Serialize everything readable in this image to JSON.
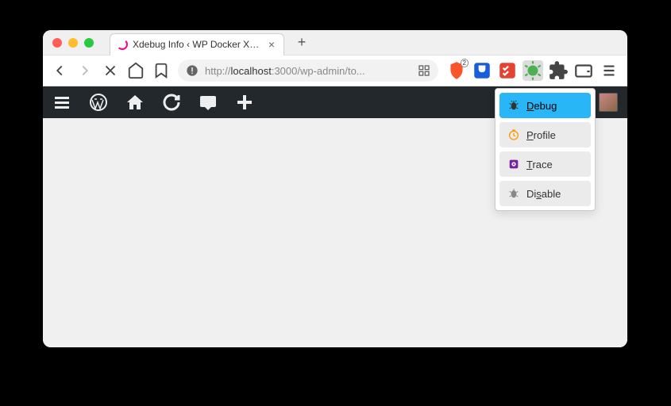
{
  "tab": {
    "title": "Xdebug Info ‹ WP Docker Xdebu"
  },
  "address": {
    "prefix": "http://",
    "host": "localhost",
    "rest": ":3000/wp-admin/to..."
  },
  "brave_badge": "2",
  "xdebug_popup": {
    "items": [
      {
        "label": "Debug",
        "underline_idx": 0
      },
      {
        "label": "Profile",
        "underline_idx": 0
      },
      {
        "label": "Trace",
        "underline_idx": 0
      },
      {
        "label": "Disable",
        "underline_idx": 2
      }
    ]
  }
}
